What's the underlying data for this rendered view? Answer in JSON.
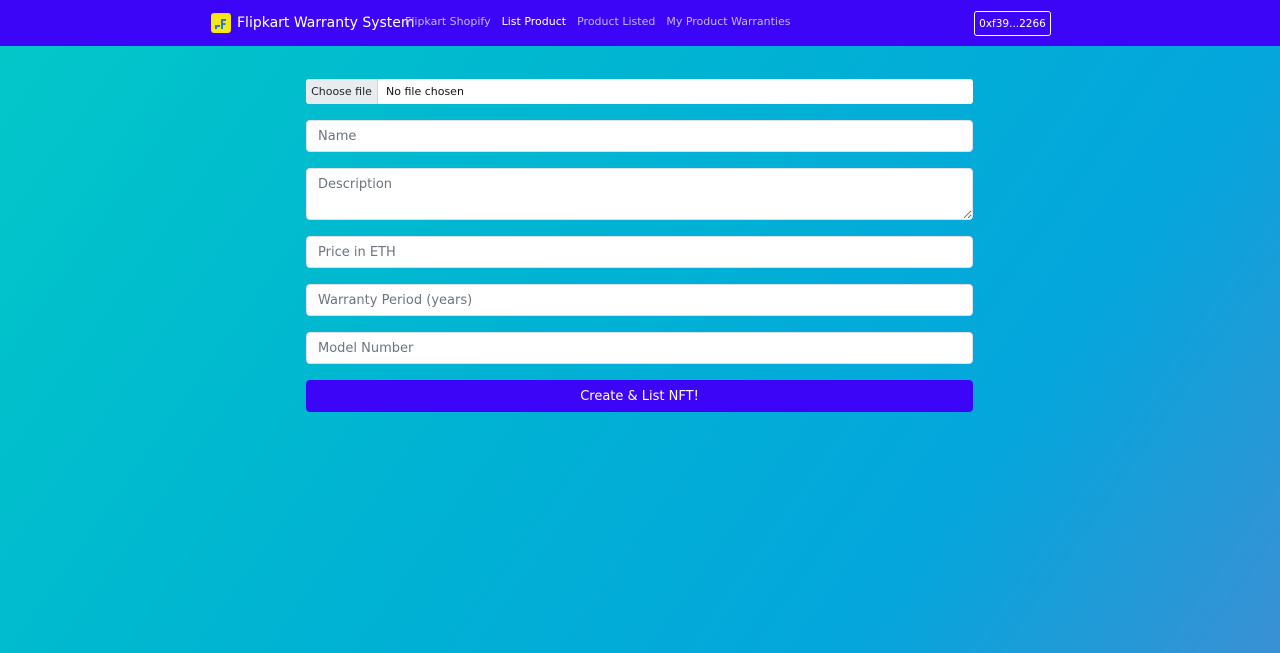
{
  "navbar": {
    "brand": "Flipkart Warranty System",
    "links": [
      {
        "label": "Flipkart Shopify",
        "active": false
      },
      {
        "label": "List Product",
        "active": true
      },
      {
        "label": "Product Listed",
        "active": false
      },
      {
        "label": "My Product Warranties",
        "active": false
      }
    ],
    "wallet": "0xf39...2266"
  },
  "form": {
    "file": {
      "button_label": "Choose file",
      "status": "No file chosen"
    },
    "name_placeholder": "Name",
    "description_placeholder": "Description",
    "price_placeholder": "Price in ETH",
    "warranty_placeholder": "Warranty Period (years)",
    "model_placeholder": "Model Number",
    "submit_label": "Create & List NFT!"
  },
  "colors": {
    "navbar": "#3d05f7",
    "button": "#3d05f7",
    "logo": "#f6e817",
    "background_start": "#02c8c8",
    "background_end": "#3a90d4"
  },
  "icons": {
    "logo": "flipkart-logo-icon"
  }
}
